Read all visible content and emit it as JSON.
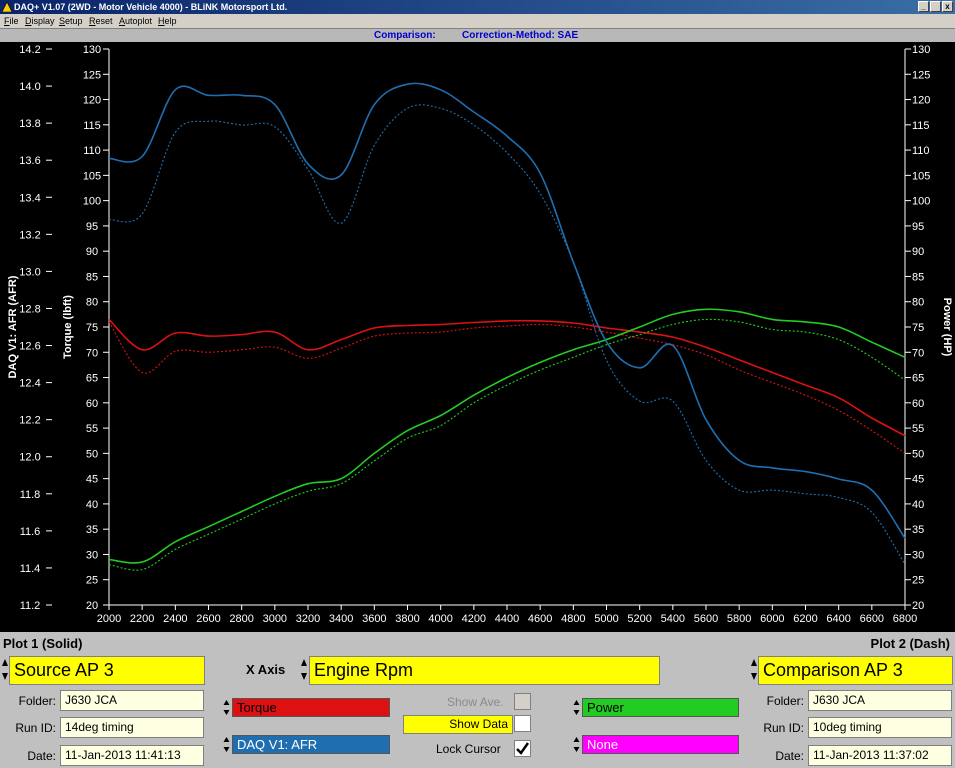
{
  "window": {
    "title": "DAQ+ V1.07 (2WD - Motor Vehicle 4000) - BLiNK Motorsport Ltd.",
    "controls": [
      "_",
      " ",
      "x"
    ]
  },
  "menu": [
    "File",
    "Display",
    "Setup",
    "Reset",
    "Autoplot",
    "Help"
  ],
  "infobar": {
    "left": "Comparison:",
    "right": "Correction-Method: SAE"
  },
  "colors": {
    "torque": "#dd1111",
    "afr": "#1f6fb0",
    "power": "#22cc22",
    "none": "#ff00ff",
    "yellow": "#ffff00"
  },
  "bottom": {
    "plot1_title": "Plot 1 (Solid)",
    "plot2_title": "Plot 2 (Dash)",
    "plot1_source": "Source AP 3",
    "plot2_source": "Comparison AP 3",
    "x_axis_label": "X Axis",
    "x_axis_value": "Engine Rpm",
    "folder_label": "Folder:",
    "runid_label": "Run ID:",
    "date_label": "Date:",
    "plot1_folder": "J630 JCA",
    "plot1_runid": "14deg timing",
    "plot1_date": "11-Jan-2013 11:41:13",
    "plot2_folder": "J630 JCA",
    "plot2_runid": "10deg timing",
    "plot2_date": "11-Jan-2013 11:37:02",
    "channels": {
      "torque": "Torque",
      "afr": "DAQ V1: AFR",
      "power": "Power",
      "none": "None"
    },
    "show_ave": "Show Ave.",
    "show_data": "Show Data",
    "lock_cursor": "Lock Cursor",
    "lock_cursor_checked": true
  },
  "chart_data": {
    "type": "line",
    "x_label": "",
    "xlim": [
      2000,
      6800
    ],
    "x_ticks": [
      2000,
      2200,
      2400,
      2600,
      2800,
      3000,
      3200,
      3400,
      3600,
      3800,
      4000,
      4200,
      4400,
      4600,
      4800,
      5000,
      5200,
      5400,
      5600,
      5800,
      6000,
      6200,
      6400,
      6600,
      6800
    ],
    "left_afr_axis": {
      "label": "DAQ V1: AFR (AFR)",
      "range": [
        11.2,
        14.2
      ],
      "ticks": [
        "14.2",
        "14.0",
        "13.8",
        "13.6",
        "13.4",
        "13.2",
        "13.0",
        "12.8",
        "12.6",
        "12.4",
        "12.2",
        "12.0",
        "11.8",
        "11.6",
        "11.4",
        "11.2"
      ]
    },
    "left_torque_axis": {
      "label": "Torque (lbft)",
      "range": [
        20,
        130
      ],
      "ticks": [
        130,
        125,
        120,
        115,
        110,
        105,
        100,
        95,
        90,
        85,
        80,
        75,
        70,
        65,
        60,
        55,
        50,
        45,
        40,
        35,
        30,
        25,
        20
      ]
    },
    "right_power_axis": {
      "label": "Power (HP)",
      "range": [
        20,
        130
      ],
      "ticks": [
        130,
        125,
        120,
        115,
        110,
        105,
        100,
        95,
        90,
        85,
        80,
        75,
        70,
        65,
        60,
        55,
        50,
        45,
        40,
        35,
        30,
        25,
        20
      ]
    },
    "grid": false,
    "x": [
      2000,
      2200,
      2400,
      2600,
      2800,
      3000,
      3200,
      3400,
      3600,
      3800,
      4000,
      4200,
      4400,
      4600,
      4800,
      5000,
      5200,
      5400,
      5600,
      5800,
      6000,
      6200,
      6400,
      6600,
      6800
    ],
    "series": [
      {
        "name": "Torque",
        "plot": 1,
        "axis": "torque",
        "color": "#dd1111",
        "style": "solid",
        "values": [
          76.5,
          70.5,
          73.8,
          73.2,
          73.5,
          74.0,
          70.5,
          72.5,
          74.8,
          75.3,
          75.5,
          75.9,
          76.2,
          76.2,
          75.8,
          74.8,
          74.0,
          73.0,
          71.0,
          68.5,
          66.0,
          63.5,
          61.0,
          57.0,
          53.5
        ]
      },
      {
        "name": "Torque",
        "plot": 2,
        "axis": "torque",
        "color": "#dd1111",
        "style": "dash",
        "values": [
          76.0,
          66.0,
          70.2,
          70.0,
          70.5,
          71.0,
          68.8,
          70.8,
          73.2,
          73.8,
          74.0,
          74.8,
          75.2,
          75.5,
          75.0,
          74.0,
          72.8,
          71.5,
          69.5,
          66.5,
          64.0,
          61.5,
          58.5,
          54.5,
          50.0
        ]
      },
      {
        "name": "Power",
        "plot": 1,
        "axis": "power",
        "color": "#22cc22",
        "style": "solid",
        "values": [
          29.0,
          28.5,
          32.5,
          35.5,
          38.5,
          41.5,
          44.0,
          45.0,
          50.0,
          54.5,
          57.5,
          61.5,
          65.0,
          68.0,
          70.5,
          72.5,
          75.0,
          77.5,
          78.5,
          78.0,
          76.5,
          76.0,
          75.0,
          72.0,
          69.0
        ]
      },
      {
        "name": "Power",
        "plot": 2,
        "axis": "power",
        "color": "#22cc22",
        "style": "dash",
        "values": [
          28.0,
          27.0,
          31.0,
          34.0,
          37.0,
          40.0,
          42.5,
          44.0,
          48.5,
          53.0,
          55.5,
          60.0,
          63.5,
          66.5,
          69.0,
          71.5,
          73.5,
          75.5,
          76.5,
          76.0,
          74.5,
          74.0,
          72.5,
          69.0,
          64.5
        ]
      },
      {
        "name": "DAQ V1: AFR",
        "plot": 1,
        "axis": "afr",
        "color": "#1f6fb0",
        "style": "solid",
        "values": [
          13.61,
          13.62,
          13.98,
          13.95,
          13.95,
          13.9,
          13.58,
          13.52,
          13.9,
          14.01,
          13.98,
          13.86,
          13.73,
          13.53,
          13.05,
          12.62,
          12.48,
          12.6,
          12.2,
          11.98,
          11.94,
          11.92,
          11.88,
          11.82,
          11.56
        ]
      },
      {
        "name": "DAQ V1: AFR",
        "plot": 2,
        "axis": "afr",
        "color": "#1f6fb0",
        "style": "dash",
        "values": [
          13.28,
          13.31,
          13.75,
          13.81,
          13.79,
          13.78,
          13.55,
          13.26,
          13.68,
          13.88,
          13.88,
          13.79,
          13.64,
          13.42,
          13.05,
          12.52,
          12.3,
          12.3,
          11.98,
          11.82,
          11.82,
          11.8,
          11.78,
          11.7,
          11.42
        ]
      }
    ]
  }
}
